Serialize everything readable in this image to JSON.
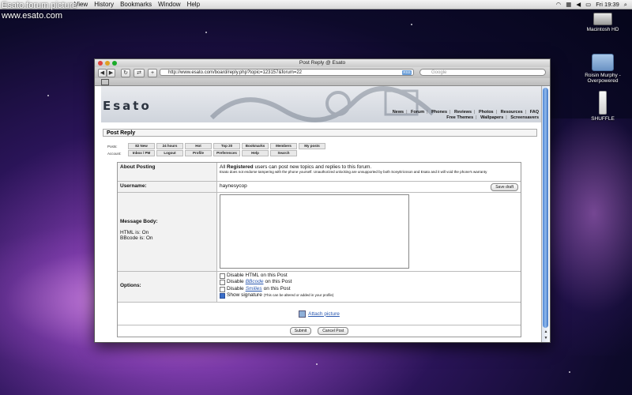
{
  "overlay": {
    "line1": "Esato.forum picture",
    "line2": "www.esato.com"
  },
  "menubar": {
    "items": [
      "View",
      "History",
      "Bookmarks",
      "Window",
      "Help"
    ],
    "clock": "Fri 19:39"
  },
  "desktop": {
    "icons": [
      {
        "label": "Macintosh HD"
      },
      {
        "label": "Roisin Murphy - Overpowered"
      },
      {
        "label": "SHUFFLE"
      }
    ]
  },
  "browser": {
    "title": "Post Reply @ Esato",
    "url": "http://www.esato.com/board/reply.php?topic=123157&forum=22",
    "rss": "RSS",
    "search_placeholder": "Google"
  },
  "site": {
    "logo": "Esato",
    "nav_row1": [
      "News",
      "Forum",
      "Phones",
      "Reviews",
      "Photos",
      "Resources",
      "FAQ"
    ],
    "nav_row2": [
      "Free Themes",
      "Wallpapers",
      "Screensavers"
    ],
    "page_heading": "Post Reply",
    "posts_label": "Posts:",
    "posts_tabs": [
      "82 New",
      "24 hours",
      "Hot",
      "Top 20",
      "Bookmarks",
      "Members",
      "My posts"
    ],
    "account_label": "Account:",
    "account_tabs": [
      "Inbox / PM",
      "Logout",
      "Profile",
      "Preferences",
      "Help",
      "Search"
    ]
  },
  "form": {
    "about_label": "About Posting",
    "about_text_pre": "All",
    "about_text_bold": "Registered",
    "about_text_post": "users can post new topics and replies to this forum.",
    "about_text_small": "Esato does not endorse tampering with the phone yourself. Unauthorized unlocking are unsupported by both SonyEricsson and Esato and it will void the phone's warranty",
    "username_label": "Username:",
    "username_value": "haynesycop",
    "save_draft": "Save draft",
    "message_label": "Message Body:",
    "html_status": "HTML is: On",
    "bbcode_status": "BBcode is: On",
    "options_label": "Options:",
    "opt1": "Disable HTML on this Post",
    "opt2_pre": "Disable",
    "opt2_link": "BBcode",
    "opt2_post": "on this Post",
    "opt3_pre": "Disable",
    "opt3_link": "Smilies",
    "opt3_post": "on this Post",
    "opt4": "Show signature",
    "opt4_note": "(This can be altered or added in your profile)",
    "attach": "Attach picture",
    "submit": "Submit",
    "cancel": "Cancel Post"
  }
}
